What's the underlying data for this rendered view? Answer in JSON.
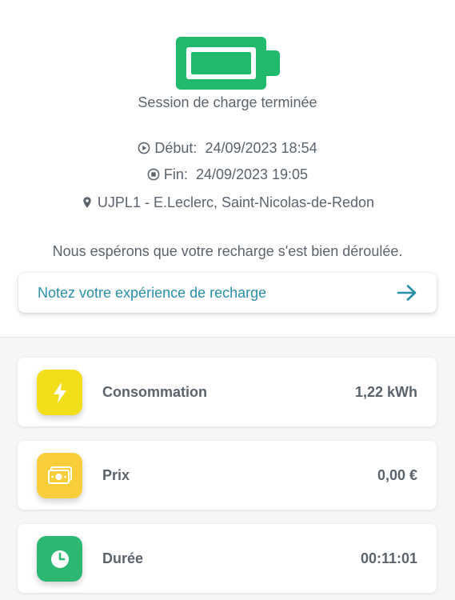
{
  "colors": {
    "battery_green": "#21b96b",
    "link_blue": "#2a8fa9",
    "consumption_yellow": "#f2de1a",
    "price_yellow": "#f8cf3a",
    "duration_green": "#2cb872"
  },
  "session": {
    "status_icon": "battery-full-icon",
    "status_text": "Session de charge terminée",
    "start_label": "Début:",
    "start_value": "24/09/2023 18:54",
    "end_label": "Fin:",
    "end_value": "24/09/2023 19:05",
    "location": "UJPL1 - E.Leclerc, Saint-Nicolas-de-Redon"
  },
  "feedback": {
    "message": "Nous espérons que votre recharge s'est bien déroulée.",
    "rate_label": "Notez votre expérience de recharge"
  },
  "stats": [
    {
      "icon": "lightning-icon",
      "label": "Consommation",
      "value": "1,22 kWh"
    },
    {
      "icon": "money-icon",
      "label": "Prix",
      "value": "0,00 €"
    },
    {
      "icon": "clock-icon",
      "label": "Durée",
      "value": "00:11:01"
    }
  ]
}
